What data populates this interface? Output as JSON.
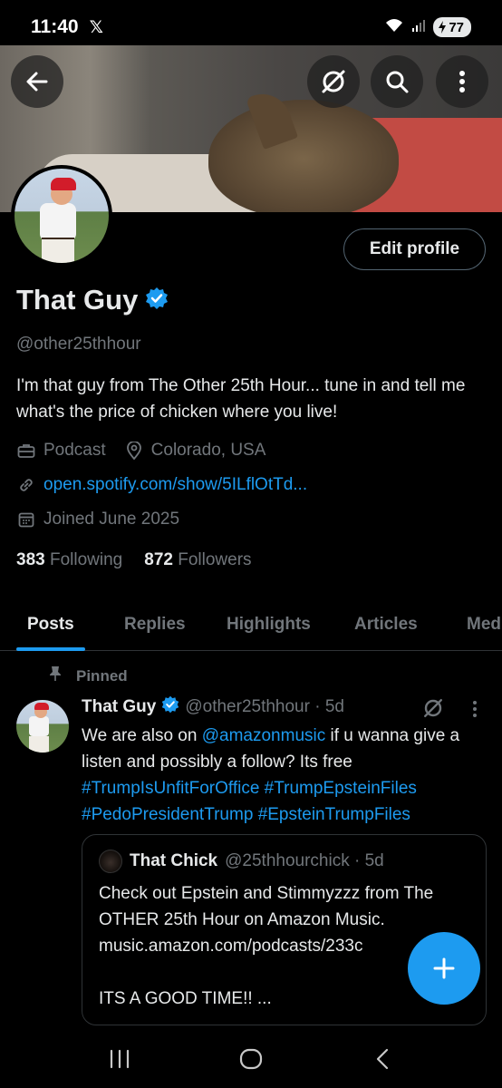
{
  "status_bar": {
    "time": "11:40",
    "x_logo": "𝕏",
    "battery": "77"
  },
  "header": {
    "back_icon": "arrow-left-icon",
    "grok_icon": "grok-icon",
    "search_icon": "search-icon",
    "more_icon": "more-vertical-icon"
  },
  "profile": {
    "edit_profile_label": "Edit profile",
    "display_name": "That Guy",
    "handle": "@other25thhour",
    "bio": "I'm that guy from The Other 25th Hour... tune in and tell me what's the price of chicken where you live!",
    "category": "Podcast",
    "location": "Colorado, USA",
    "website": "open.spotify.com/show/5ILflOtTd...",
    "joined": "Joined June 2025",
    "following_count": "383",
    "following_label": "Following",
    "followers_count": "872",
    "followers_label": "Followers"
  },
  "tabs": [
    {
      "label": "Posts",
      "active": true
    },
    {
      "label": "Replies",
      "active": false
    },
    {
      "label": "Highlights",
      "active": false
    },
    {
      "label": "Articles",
      "active": false
    },
    {
      "label": "Med",
      "active": false
    }
  ],
  "pinned_post": {
    "pinned_label": "Pinned",
    "author_name": "That Guy",
    "author_handle_time": "@other25thhour · 5d",
    "text_prefix": "We are also on ",
    "mention": "@amazonmusic",
    "text_suffix": " if u wanna give a listen and possibly a follow? Its free",
    "hashtags": [
      "#TrumpIsUnfitForOffice",
      "#TrumpEpsteinFiles",
      "#PedoPresidentTrump",
      "#EpsteinTrumpFiles"
    ],
    "quote": {
      "author_name": "That Chick",
      "author_handle_time": "@25thhourchick · 5d",
      "text": "Check out Epstein and Stimmyzzz from The OTHER 25th Hour on Amazon Music. music.amazon.com/podcasts/233c\n\nITS A GOOD TIME!! ..."
    }
  },
  "colors": {
    "accent": "#1d9bf0",
    "muted": "#71767b",
    "text": "#e7e9ea",
    "background": "#000000"
  }
}
